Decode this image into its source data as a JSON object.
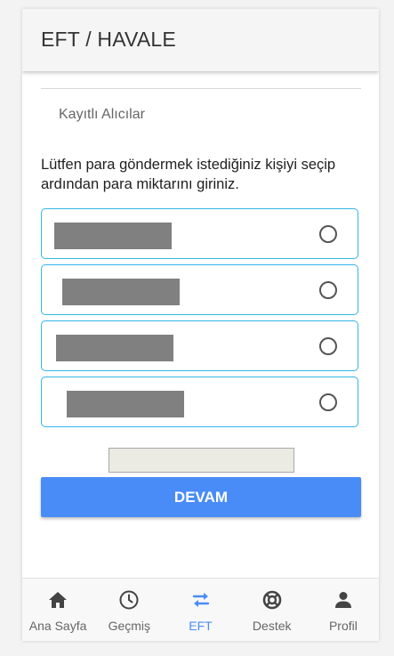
{
  "header": {
    "title": "EFT / HAVALE"
  },
  "section": {
    "label": "Kayıtlı Alıcılar"
  },
  "instructions": "Lütfen para göndermek istediğiniz kişiyi seçip ardından para miktarını giriniz.",
  "recipients": [
    {
      "name_redacted": true,
      "selected": false
    },
    {
      "name_redacted": true,
      "selected": false
    },
    {
      "name_redacted": true,
      "selected": false
    },
    {
      "name_redacted": true,
      "selected": false
    }
  ],
  "amount": {
    "value": ""
  },
  "continue_button": {
    "label": "DEVAM"
  },
  "tabbar": {
    "items": [
      {
        "label": "Ana Sayfa",
        "icon": "home-icon",
        "active": false
      },
      {
        "label": "Geçmiş",
        "icon": "clock-icon",
        "active": false
      },
      {
        "label": "EFT",
        "icon": "transfer-arrows-icon",
        "active": true
      },
      {
        "label": "Destek",
        "icon": "lifebuoy-icon",
        "active": false
      },
      {
        "label": "Profil",
        "icon": "person-icon",
        "active": false
      }
    ]
  },
  "colors": {
    "accent": "#4a8cf7",
    "card_border": "#35b6e6",
    "redaction": "#808080"
  }
}
